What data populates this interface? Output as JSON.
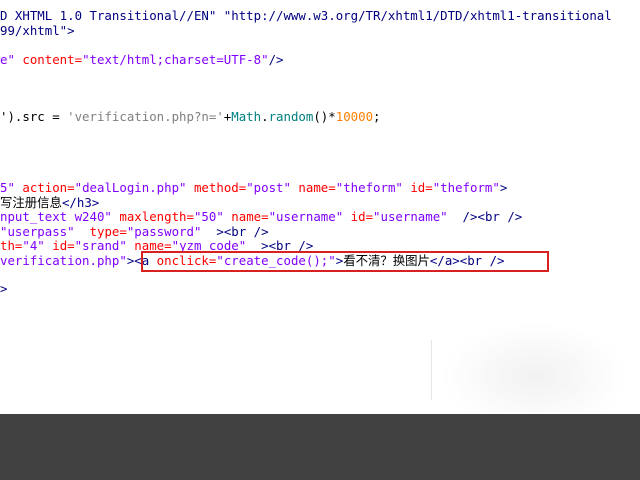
{
  "editor": {
    "lines": [
      {
        "parts": [
          {
            "c": "tg",
            "t": "D XHTML 1.0 Transitional//EN\" \"http://www.w3.org/TR/xhtml1/DTD/xhtml1-transitional"
          }
        ]
      },
      {
        "parts": [
          {
            "c": "tg",
            "t": "99/xhtml\">"
          }
        ]
      },
      {
        "parts": [
          {
            "c": "av",
            "t": "e\""
          },
          {
            "c": "an",
            "t": " content="
          },
          {
            "c": "av",
            "t": "\"text/html;charset=UTF-8\""
          },
          {
            "c": "tg",
            "t": "/>"
          }
        ]
      },
      {
        "parts": [
          {
            "c": "txt",
            "t": "').src = "
          },
          {
            "c": "str",
            "t": "'verification.php?n='"
          },
          {
            "c": "txt",
            "t": "+"
          },
          {
            "c": "js",
            "t": "Math"
          },
          {
            "c": "txt",
            "t": "."
          },
          {
            "c": "js",
            "t": "random"
          },
          {
            "c": "txt",
            "t": "()*"
          },
          {
            "c": "num",
            "t": "10000"
          },
          {
            "c": "txt",
            "t": ";"
          }
        ]
      },
      {
        "parts": [
          {
            "c": "av",
            "t": "5\""
          },
          {
            "c": "an",
            "t": " action="
          },
          {
            "c": "av",
            "t": "\"dealLogin.php\""
          },
          {
            "c": "an",
            "t": " method="
          },
          {
            "c": "av",
            "t": "\"post\""
          },
          {
            "c": "an",
            "t": " name="
          },
          {
            "c": "av",
            "t": "\"theform\""
          },
          {
            "c": "an",
            "t": " id="
          },
          {
            "c": "av",
            "t": "\"theform\""
          },
          {
            "c": "tg",
            "t": ">"
          }
        ]
      },
      {
        "parts": [
          {
            "c": "txt",
            "t": "写注册信息"
          },
          {
            "c": "tg",
            "t": "</h3>"
          }
        ]
      },
      {
        "parts": [
          {
            "c": "av",
            "t": "nput_text w240\""
          },
          {
            "c": "an",
            "t": " maxlength="
          },
          {
            "c": "av",
            "t": "\"50\""
          },
          {
            "c": "an",
            "t": " name="
          },
          {
            "c": "av",
            "t": "\"username\""
          },
          {
            "c": "an",
            "t": " id="
          },
          {
            "c": "av",
            "t": "\"username\""
          },
          {
            "c": "tg",
            "t": "  /><br />"
          }
        ]
      },
      {
        "parts": [
          {
            "c": "av",
            "t": "\"userpass\""
          },
          {
            "c": "an",
            "t": "  type="
          },
          {
            "c": "av",
            "t": "\"password\""
          },
          {
            "c": "tg",
            "t": "  ><br />"
          }
        ]
      },
      {
        "parts": [
          {
            "c": "an",
            "t": "th="
          },
          {
            "c": "av",
            "t": "\"4\""
          },
          {
            "c": "an",
            "t": " id="
          },
          {
            "c": "av",
            "t": "\"srand\""
          },
          {
            "c": "an",
            "t": " name="
          },
          {
            "c": "av",
            "t": "\"yzm_code\""
          },
          {
            "c": "tg",
            "t": "  ><br />"
          }
        ]
      },
      {
        "parts": [
          {
            "c": "av",
            "t": "verification.php\""
          },
          {
            "c": "tg",
            "t": ">"
          },
          {
            "c": "tg",
            "t": "<a"
          },
          {
            "c": "an",
            "t": " onclick="
          },
          {
            "c": "av",
            "t": "\"create_code();\""
          },
          {
            "c": "tg",
            "t": ">"
          },
          {
            "c": "txt",
            "t": "看不清？换图片"
          },
          {
            "c": "tg",
            "t": "</a><br />"
          }
        ]
      },
      {
        "parts": [
          {
            "c": "tg",
            "t": ">"
          }
        ]
      }
    ]
  },
  "colors": {
    "editor_bg": "#ffffff",
    "bottom_band": "#414141",
    "tag": "#000080",
    "attr_name": "#ff0000",
    "attr_value": "#8000ff",
    "highlight_border": "#d82020"
  }
}
